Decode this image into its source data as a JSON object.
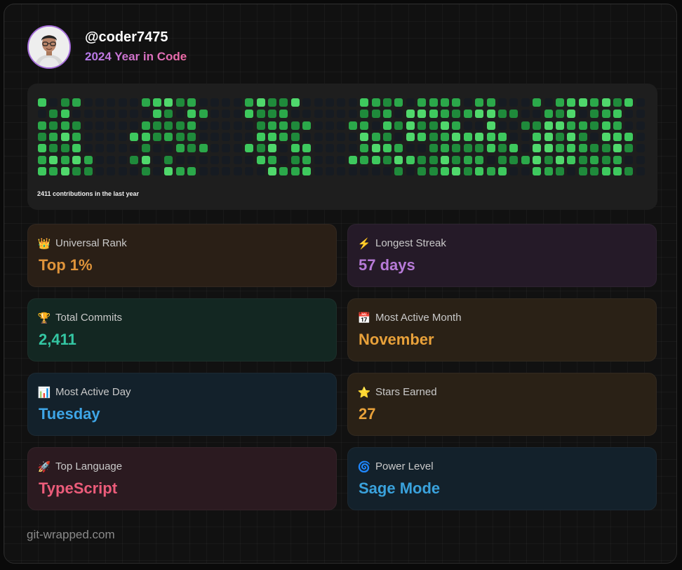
{
  "profile": {
    "username": "@coder7475",
    "subtitle": "2024 Year in Code"
  },
  "heatmap": {
    "contributions_text": "2411 contributions in the last year",
    "weeks": 53,
    "days": 7,
    "colors": [
      "#161b22",
      "#1f8a3b",
      "#2ba84a",
      "#3ec95e",
      "#50d86c"
    ],
    "empty_columns": [
      5,
      6,
      7,
      15,
      16,
      17,
      24,
      25,
      26,
      52
    ],
    "sparse_columns": [
      4,
      8,
      14,
      18,
      23,
      27,
      41,
      42,
      51
    ]
  },
  "stats": [
    {
      "id": "universal-rank",
      "icon": "crown-icon",
      "glyph": "👑",
      "label": "Universal Rank",
      "value": "Top 1%",
      "color": "#e0943a",
      "bg": "#2a1f16"
    },
    {
      "id": "longest-streak",
      "icon": "lightning-icon",
      "glyph": "⚡",
      "label": "Longest Streak",
      "value": "57 days",
      "color": "#b77ad8",
      "bg": "#251a28"
    },
    {
      "id": "total-commits",
      "icon": "trophy-icon",
      "glyph": "🏆",
      "label": "Total Commits",
      "value": "2,411",
      "color": "#34c6a3",
      "bg": "#132722"
    },
    {
      "id": "most-active-month",
      "icon": "calendar-icon",
      "glyph": "📅",
      "label": "Most Active Month",
      "value": "November",
      "color": "#e8a13a",
      "bg": "#2a2116"
    },
    {
      "id": "most-active-day",
      "icon": "bar-chart-icon",
      "glyph": "📊",
      "label": "Most Active Day",
      "value": "Tuesday",
      "color": "#3ea5e6",
      "bg": "#13212b"
    },
    {
      "id": "stars-earned",
      "icon": "star-icon",
      "glyph": "⭐",
      "label": "Stars Earned",
      "value": "27",
      "color": "#e8a13a",
      "bg": "#2a2116"
    },
    {
      "id": "top-language",
      "icon": "rocket-icon",
      "glyph": "🚀",
      "label": "Top Language",
      "value": "TypeScript",
      "color": "#ec5c7a",
      "bg": "#2b1a20"
    },
    {
      "id": "power-level",
      "icon": "spiral-icon",
      "glyph": "🌀",
      "label": "Power Level",
      "value": "Sage Mode",
      "color": "#3aa2dc",
      "bg": "#13212b"
    }
  ],
  "footer": {
    "site": "git-wrapped.com"
  }
}
